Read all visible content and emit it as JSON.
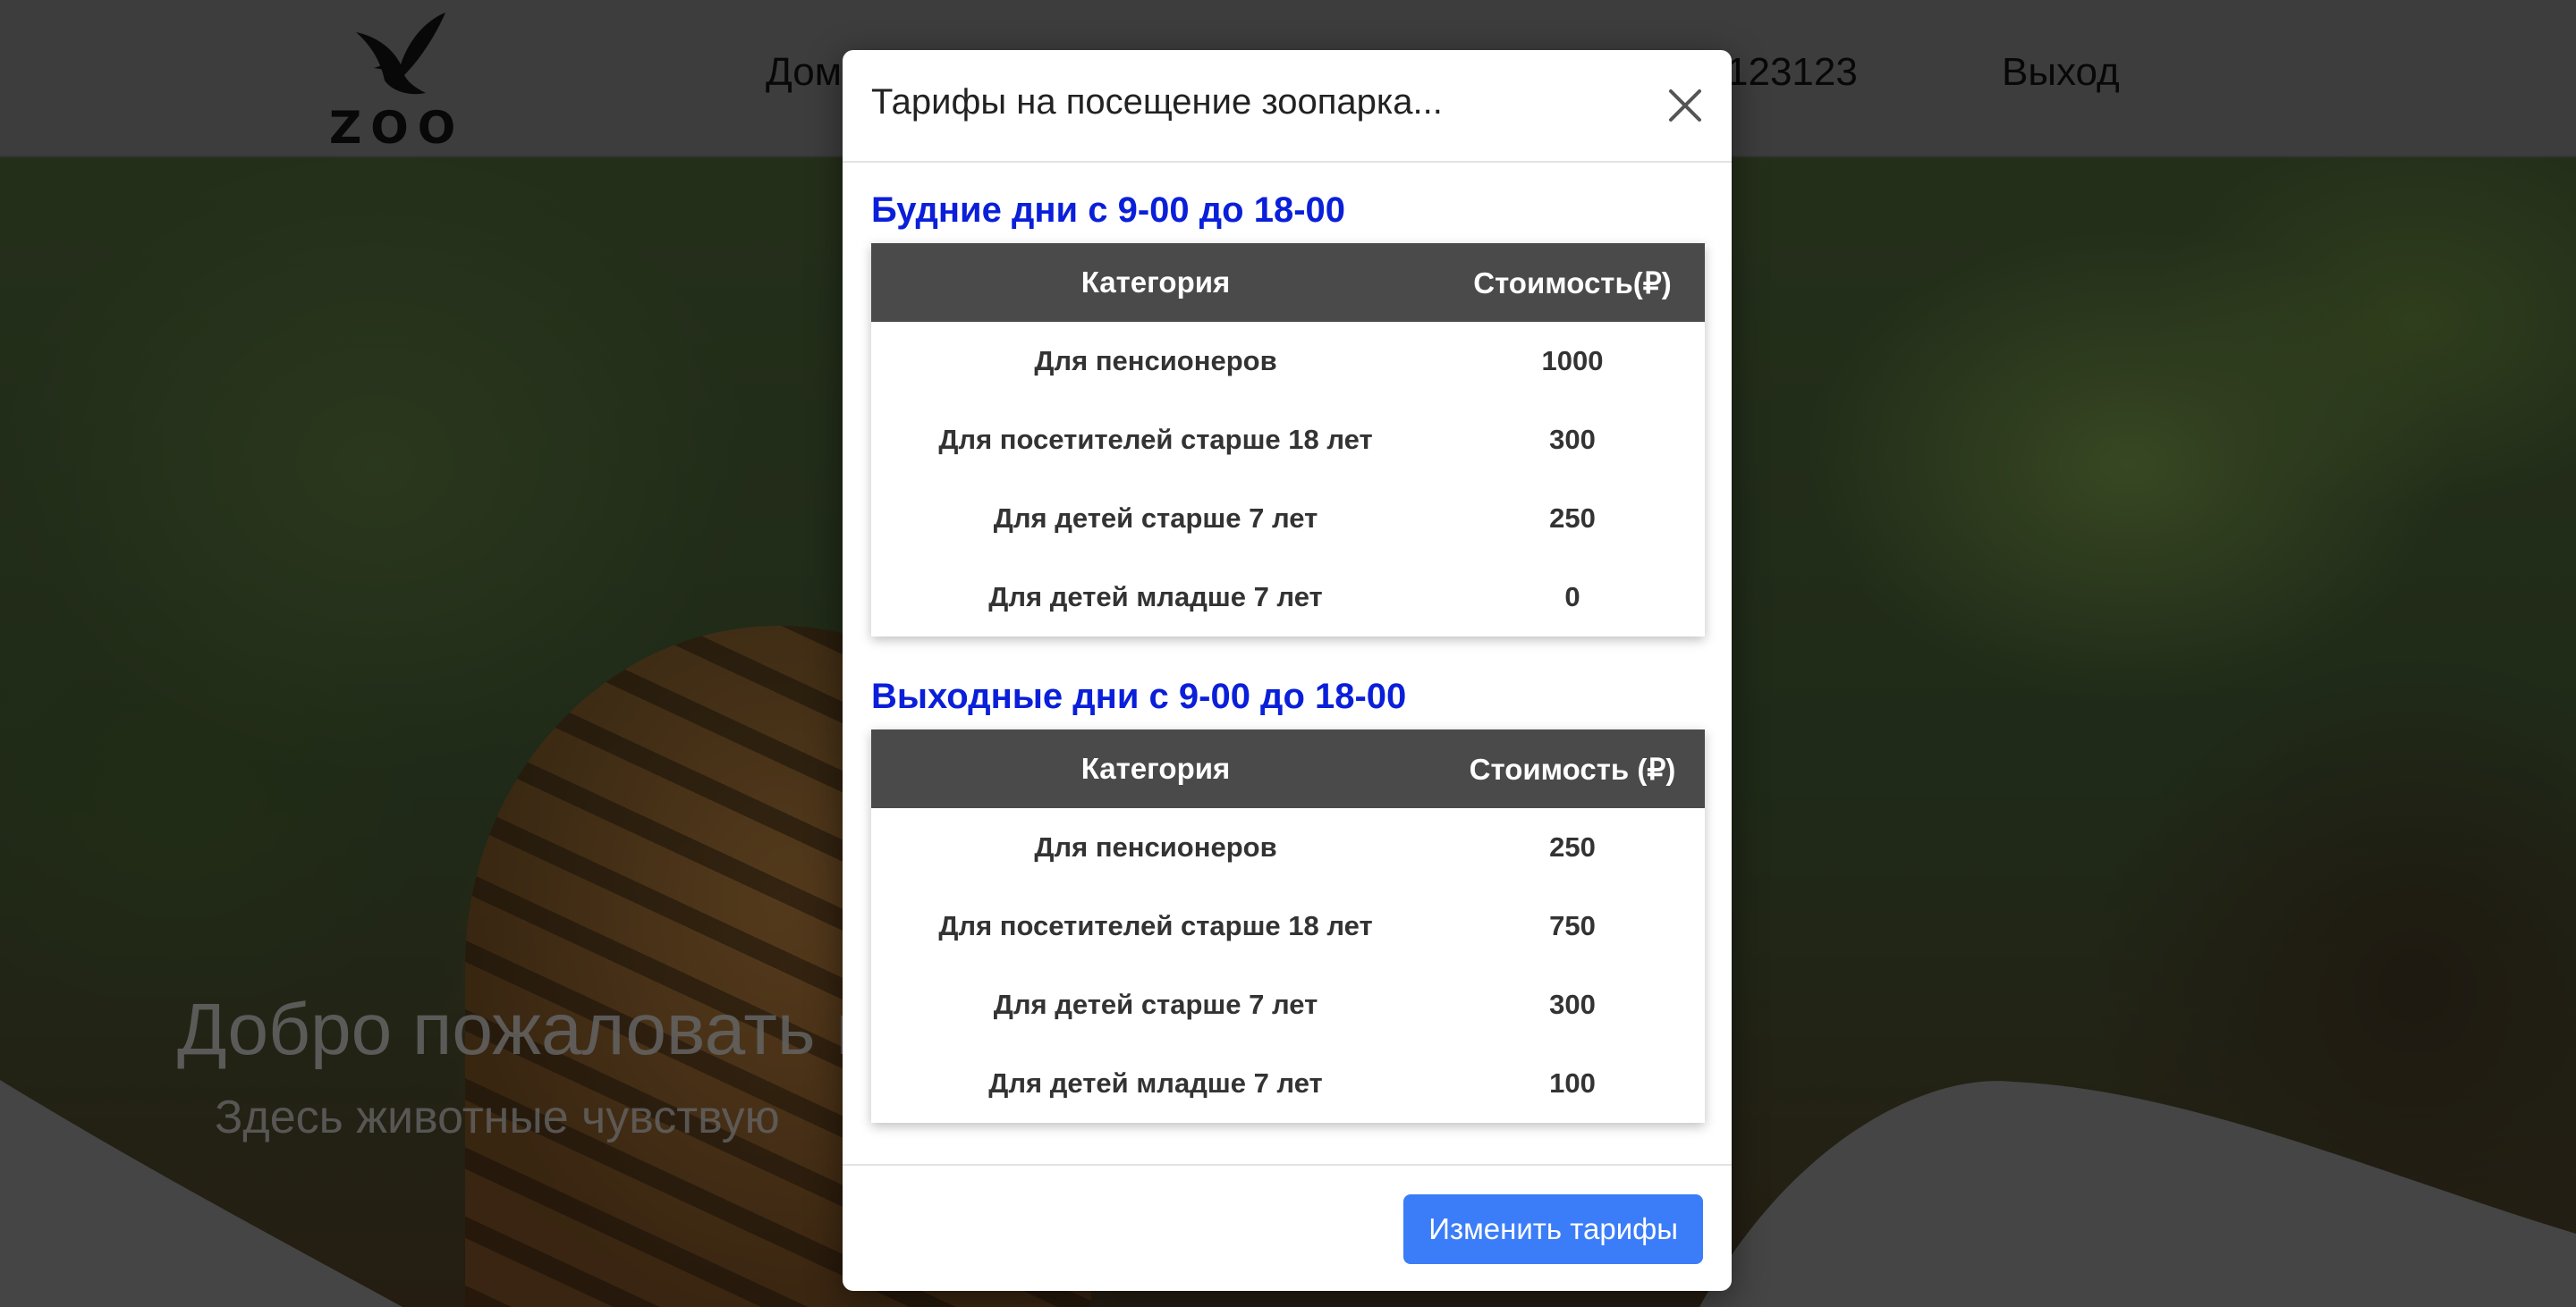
{
  "header": {
    "logo_text": "ZOO",
    "nav_home_partial": "Дом",
    "nav_phone_partial": "123123",
    "nav_logout": "Выход"
  },
  "hero": {
    "title_partial": "Добро пожаловать в",
    "subtitle_partial": "Здесь животные чувствую"
  },
  "modal": {
    "title": "Тарифы на посещение зоопарка...",
    "close_icon": "close-icon",
    "weekdays": {
      "title": "Будние дни с 9-00 до 18-00",
      "columns": [
        "Категория",
        "Стоимость(₽)"
      ],
      "rows": [
        {
          "category": "Для пенсионеров",
          "price": "1000"
        },
        {
          "category": "Для посетителей старше 18 лет",
          "price": "300"
        },
        {
          "category": "Для детей старше 7 лет",
          "price": "250"
        },
        {
          "category": "Для детей младше 7 лет",
          "price": "0"
        }
      ]
    },
    "weekends": {
      "title": "Выходные дни с 9-00 до 18-00",
      "columns": [
        "Категория",
        "Стоимость (₽)"
      ],
      "rows": [
        {
          "category": "Для пенсионеров",
          "price": "250"
        },
        {
          "category": "Для посетителей старше 18 лет",
          "price": "750"
        },
        {
          "category": "Для детей старше 7 лет",
          "price": "300"
        },
        {
          "category": "Для детей младше 7 лет",
          "price": "100"
        }
      ]
    },
    "change_button_label": "Изменить тарифы"
  },
  "colors": {
    "section_title": "#0a1fd9",
    "table_header_bg": "#4a4a4a",
    "button_bg": "#3b7df8"
  }
}
